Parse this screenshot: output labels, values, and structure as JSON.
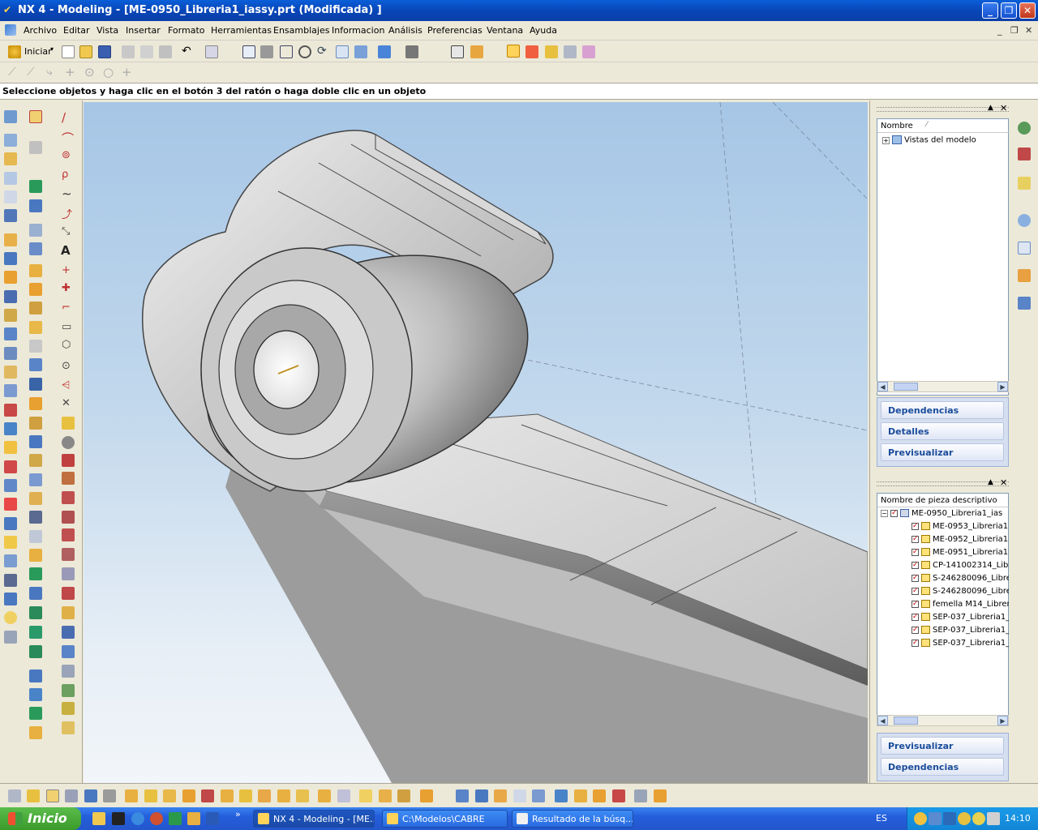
{
  "window": {
    "title": "NX 4 - Modeling - [ME-0950_Libreria1_iassy.prt (Modificada) ]",
    "controls": [
      "_",
      "❐",
      "✕"
    ]
  },
  "menu": {
    "items": [
      "Archivo",
      "Editar",
      "Vista",
      "Insertar",
      "Formato",
      "Herramientas",
      "Ensamblajes",
      "Informacion",
      "Análisis",
      "Preferencias",
      "Ventana",
      "Ayuda"
    ],
    "mdi_controls": [
      "_",
      "❐",
      "✕"
    ]
  },
  "toolbar": {
    "start_label": "Iniciar"
  },
  "prompt": {
    "text": "Seleccione objetos y haga clic en el botón 3 del ratón o haga doble clic en un objeto"
  },
  "navigator_top": {
    "column_header": "Nombre",
    "tree_item": "Vistas del modelo",
    "buttons": [
      "Dependencias",
      "Detalles",
      "Previsualizar"
    ]
  },
  "navigator_bottom": {
    "column_header": "Nombre de pieza descriptivo",
    "root": "ME-0950_Libreria1_ias",
    "children": [
      "ME-0953_Libreria1",
      "ME-0952_Libreria1",
      "ME-0951_Libreria1",
      "CP-141002314_Lib",
      "S-246280096_Libre",
      "S-246280096_Libre",
      "femella M14_Librer",
      "SEP-037_Libreria1_",
      "SEP-037_Libreria1_",
      "SEP-037_Libreria1_"
    ],
    "buttons": [
      "Previsualizar",
      "Dependencias"
    ]
  },
  "taskbar": {
    "start_label": "Inicio",
    "tasks": [
      "NX 4 - Modeling - [ME...",
      "C:\\Modelos\\CABRE",
      "Resultado de la búsq..."
    ],
    "language": "ES",
    "clock": "14:10",
    "quicklaunch_overflow": "»"
  },
  "colors": {
    "title_bar": "#0a4fd0",
    "viewport_top": "#a6c6e6",
    "viewport_bottom": "#f2f5f9",
    "taskbar": "#245edb",
    "start_button": "#3a9a2a"
  }
}
